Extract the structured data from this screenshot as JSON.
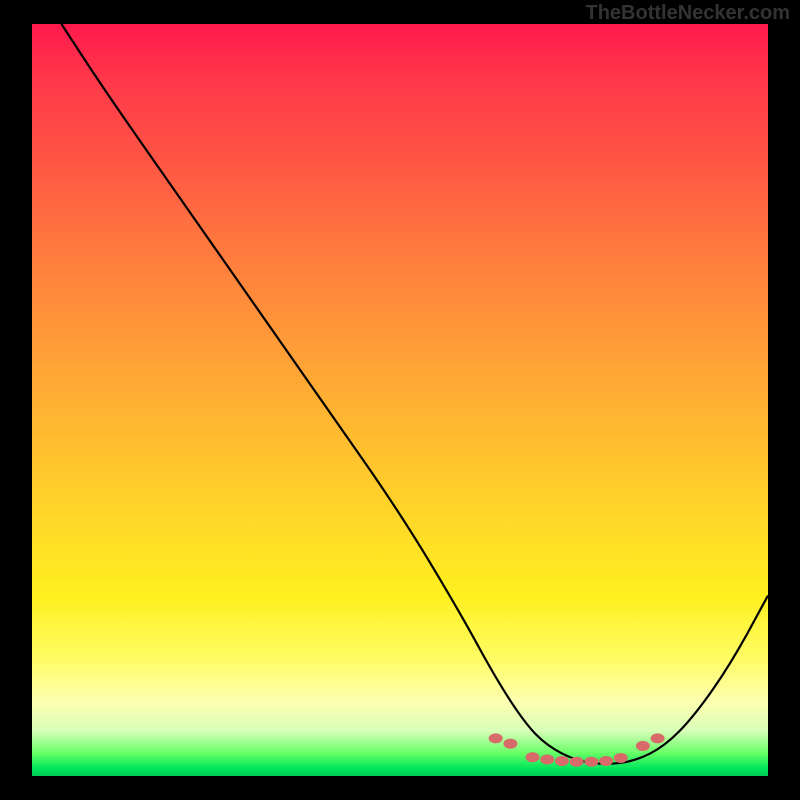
{
  "watermark": "TheBottleNecker.com",
  "chart_data": {
    "type": "line",
    "title": "",
    "xlabel": "",
    "ylabel": "",
    "xlim": [
      0,
      100
    ],
    "ylim": [
      0,
      100
    ],
    "series": [
      {
        "name": "bottleneck-curve",
        "x": [
          4,
          10,
          20,
          30,
          40,
          50,
          58,
          63,
          67,
          70,
          74,
          78,
          82,
          86,
          90,
          95,
          100
        ],
        "values": [
          100,
          91,
          77,
          63,
          49,
          35,
          22,
          13,
          7,
          4,
          2,
          1.5,
          2,
          4,
          8,
          15,
          24
        ]
      }
    ],
    "markers": {
      "name": "optimal-range-dots",
      "color": "#d86a6a",
      "points": [
        {
          "x": 63,
          "y": 5.0
        },
        {
          "x": 65,
          "y": 4.3
        },
        {
          "x": 68,
          "y": 2.5
        },
        {
          "x": 70,
          "y": 2.2
        },
        {
          "x": 72,
          "y": 2.0
        },
        {
          "x": 74,
          "y": 1.9
        },
        {
          "x": 76,
          "y": 1.9
        },
        {
          "x": 78,
          "y": 2.0
        },
        {
          "x": 80,
          "y": 2.4
        },
        {
          "x": 83,
          "y": 4.0
        },
        {
          "x": 85,
          "y": 5.0
        }
      ]
    },
    "gradient_stops": [
      {
        "pos": 0,
        "color": "#ff1a4d"
      },
      {
        "pos": 50,
        "color": "#ffba30"
      },
      {
        "pos": 85,
        "color": "#fffc60"
      },
      {
        "pos": 100,
        "color": "#00cc55"
      }
    ]
  }
}
